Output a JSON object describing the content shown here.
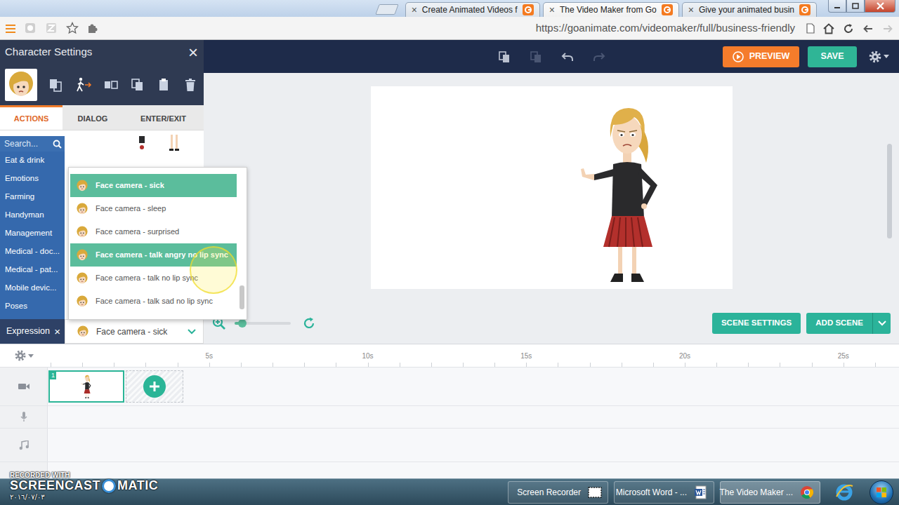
{
  "browser": {
    "tabs": [
      {
        "label": "Create Animated Videos f",
        "close": "×",
        "selected": false
      },
      {
        "label": "The Video Maker from Go",
        "close": "×",
        "selected": true
      },
      {
        "label": "Give your animated busin",
        "close": "×",
        "selected": false
      }
    ],
    "url": "https://goanimate.com/videomaker/full/business-friendly"
  },
  "toolbar": {
    "preview": "PREVIEW",
    "save": "SAVE"
  },
  "character_settings": {
    "title": "Character Settings",
    "close": "×",
    "tabs": [
      {
        "label": "ACTIONS",
        "selected": true
      },
      {
        "label": "DIALOG",
        "selected": false
      },
      {
        "label": "ENTER/EXIT",
        "selected": false
      }
    ],
    "search": {
      "placeholder": "Search..."
    },
    "categories": [
      "Eat & drink",
      "Emotions",
      "Farming",
      "Handyman",
      "Management",
      "Medical - doc...",
      "Medical - pat...",
      "Mobile devic...",
      "Poses"
    ],
    "expression": {
      "label": "Expression",
      "clear": "×",
      "value": "Face camera - sick",
      "options": [
        {
          "label": "Face camera - sick",
          "selected": true,
          "hovered": false
        },
        {
          "label": "Face camera - sleep",
          "selected": false,
          "hovered": false
        },
        {
          "label": "Face camera - surprised",
          "selected": false,
          "hovered": false
        },
        {
          "label": "Face camera - talk angry no lip sync",
          "selected": false,
          "hovered": true
        },
        {
          "label": "Face camera - talk no lip sync",
          "selected": false,
          "hovered": false
        },
        {
          "label": "Face camera - talk sad no lip sync",
          "selected": false,
          "hovered": false
        }
      ]
    }
  },
  "stage": {
    "zoom": {
      "level": 0.14
    },
    "scene_settings": "SCENE SETTINGS",
    "add_scene": "ADD SCENE"
  },
  "timeline": {
    "ticks": [
      "5s",
      "10s",
      "15s",
      "20s",
      "25s"
    ],
    "scenes": [
      {
        "number": "1",
        "selected": true
      }
    ]
  },
  "watermark": {
    "recorded_with": "RECORDED WITH",
    "brand_left": "SCREENCAST",
    "brand_right": "MATIC",
    "date": "٢٠١٦/٠٧/٠٣"
  },
  "taskbar": {
    "items": [
      {
        "label": "Screen Recorder",
        "kind": "recorder",
        "selected": false
      },
      {
        "label": "Microsoft Word - ...",
        "kind": "word",
        "selected": false
      },
      {
        "label": "The Video Maker ...",
        "kind": "chrome",
        "selected": true
      }
    ]
  }
}
